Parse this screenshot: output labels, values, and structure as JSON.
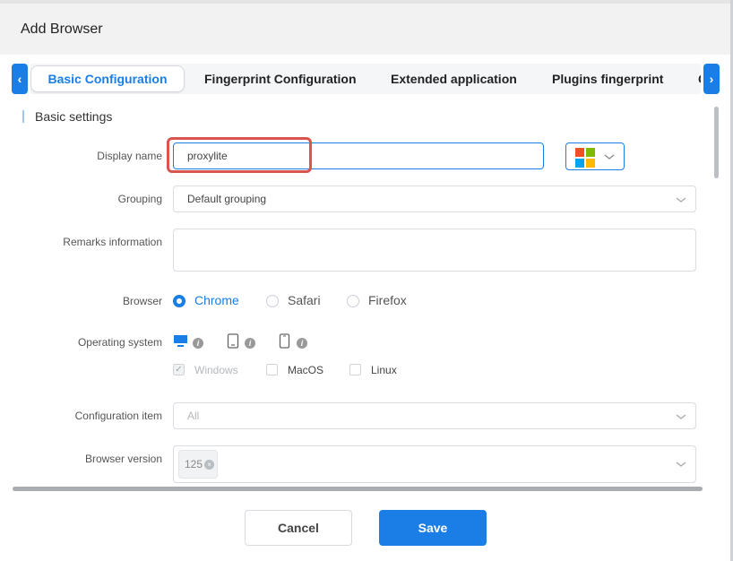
{
  "window": {
    "title": "Add Browser"
  },
  "tabs": [
    {
      "label": "Basic Configuration",
      "active": true
    },
    {
      "label": "Fingerprint Configuration"
    },
    {
      "label": "Extended application"
    },
    {
      "label": "Plugins fingerprint"
    },
    {
      "label": "C"
    }
  ],
  "nav": {
    "prev_icon": "chevron-left-icon",
    "next_icon": "chevron-right-icon",
    "prev_glyph": "‹",
    "next_glyph": "›"
  },
  "section": {
    "title": "Basic settings"
  },
  "fields": {
    "display_name": {
      "label": "Display name",
      "value": "proxylite"
    },
    "os_platform": {
      "icon": "windows-logo-icon"
    },
    "grouping": {
      "label": "Grouping",
      "value": "Default grouping"
    },
    "remarks": {
      "label": "Remarks information",
      "value": ""
    },
    "browser": {
      "label": "Browser",
      "options": [
        "Chrome",
        "Safari",
        "Firefox"
      ],
      "selected": "Chrome"
    },
    "operating_system": {
      "label": "Operating system",
      "device_icons": [
        "desktop-icon",
        "tablet-icon",
        "mobile-icon"
      ],
      "options": [
        {
          "label": "Windows",
          "checked": true,
          "disabled": true
        },
        {
          "label": "MacOS",
          "checked": false
        },
        {
          "label": "Linux",
          "checked": false
        }
      ]
    },
    "configuration_item": {
      "label": "Configuration item",
      "placeholder": "All"
    },
    "browser_version": {
      "label": "Browser version",
      "tags": [
        "125"
      ]
    }
  },
  "footer": {
    "cancel_label": "Cancel",
    "save_label": "Save"
  },
  "colors": {
    "accent": "#1a7ee6",
    "highlight": "#d9534f",
    "windows": [
      "#f25022",
      "#7fba00",
      "#00a4ef",
      "#ffb900"
    ]
  }
}
